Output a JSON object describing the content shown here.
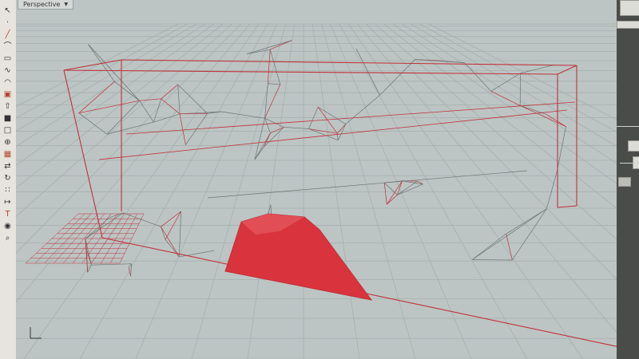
{
  "viewport": {
    "title": "Perspective",
    "dropdown_icon": "chevron-down-icon",
    "background": "#bcc5c4",
    "grid_color": "#a6b0af",
    "edge_color": "#c0313a",
    "selected_fill": "#d9333d",
    "wire_color": "#6e7373"
  },
  "toolbar": {
    "icons": [
      "select-icon",
      "point-icon",
      "line-icon",
      "polyline-icon",
      "rectangle-icon",
      "curve-icon",
      "arc-icon",
      "surface-icon",
      "extrude-icon",
      "solid-icon",
      "box-icon",
      "boolean-icon",
      "mesh-icon",
      "transform-icon",
      "rotate-icon",
      "array-icon",
      "dimension-icon",
      "text-icon",
      "render-icon",
      "analyze-icon"
    ]
  },
  "right_panel": {
    "component_icons": [
      "component-node-icon",
      "component-node-icon"
    ]
  }
}
